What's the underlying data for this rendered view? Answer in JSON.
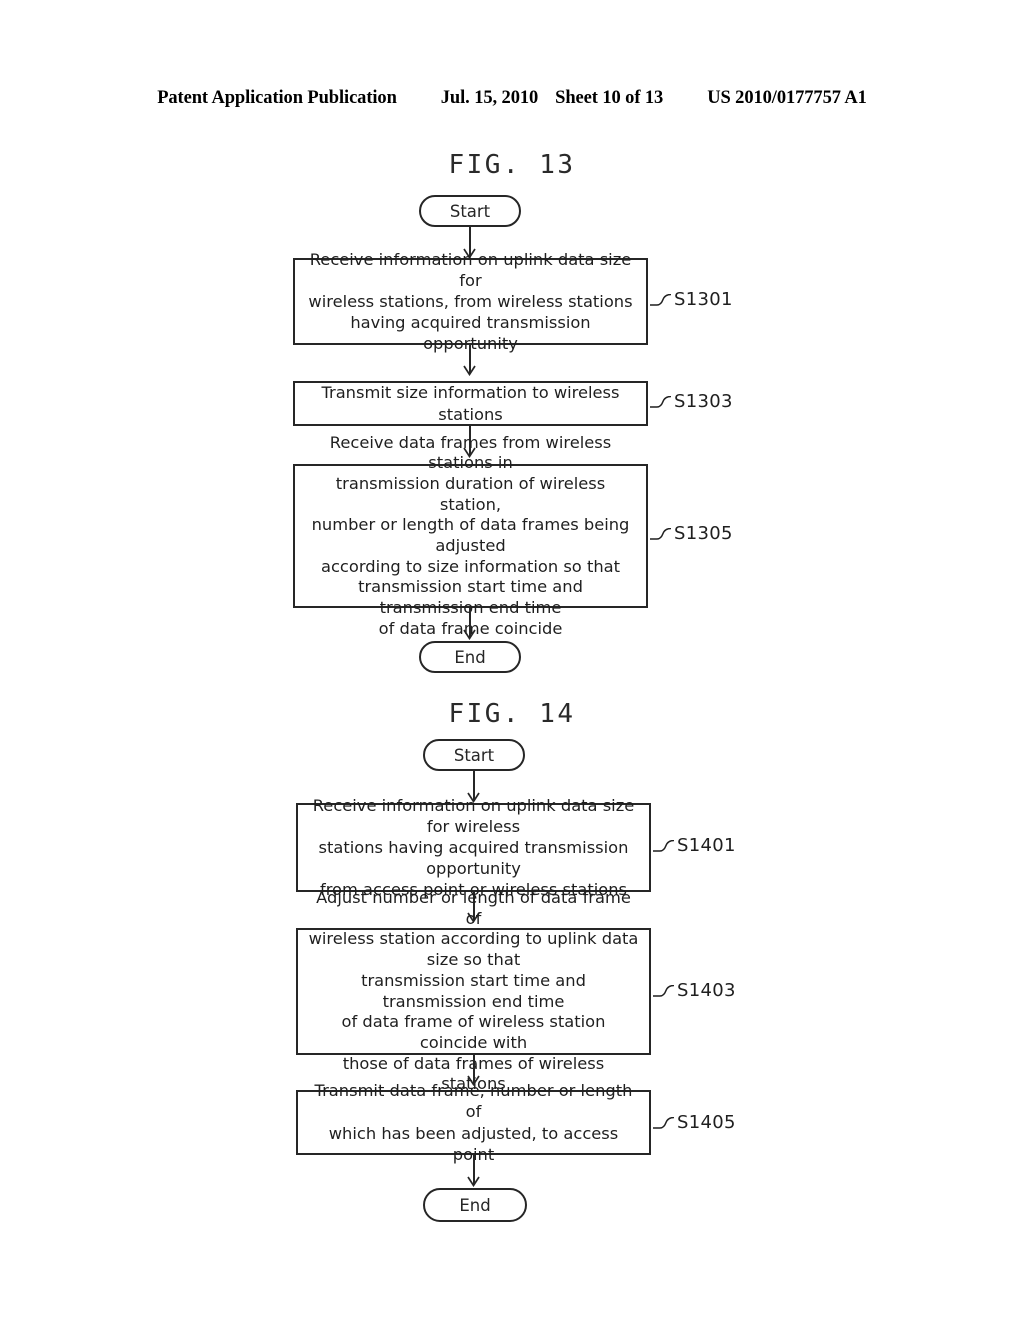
{
  "header": {
    "publication": "Patent Application Publication",
    "date": "Jul. 15, 2010",
    "sheet": "Sheet 10 of 13",
    "document_number": "US 2010/0177757 A1"
  },
  "figures": [
    {
      "title": "FIG. 13",
      "start_label": "Start",
      "end_label": "End",
      "steps": [
        {
          "ref": "S1301",
          "lines": [
            "Receive information on uplink data size for",
            "wireless stations, from wireless stations",
            "having acquired transmission opportunity"
          ]
        },
        {
          "ref": "S1303",
          "lines": [
            "Transmit size information to wireless stations"
          ]
        },
        {
          "ref": "S1305",
          "lines": [
            "Receive data frames from wireless stations in",
            "transmission duration of wireless station,",
            "number or length of data frames being adjusted",
            "according to size information so that",
            "transmission start time and transmission end time",
            "of data frame coincide"
          ]
        }
      ]
    },
    {
      "title": "FIG. 14",
      "start_label": "Start",
      "end_label": "End",
      "steps": [
        {
          "ref": "S1401",
          "lines": [
            "Receive information on uplink data size for wireless",
            "stations having acquired transmission opportunity",
            "from access point or wireless stations"
          ]
        },
        {
          "ref": "S1403",
          "lines": [
            "Adjust number or length of data frame of",
            "wireless station according to uplink data size so that",
            "transmission start time and transmission end time",
            "of data frame of wireless station coincide with",
            "those of data frames of wireless stations"
          ]
        },
        {
          "ref": "S1405",
          "lines": [
            "Transmit data frame, number or length of",
            "which has been adjusted, to access point"
          ]
        }
      ]
    }
  ],
  "colors": {
    "ink": "#262626",
    "paper": "#ffffff"
  }
}
